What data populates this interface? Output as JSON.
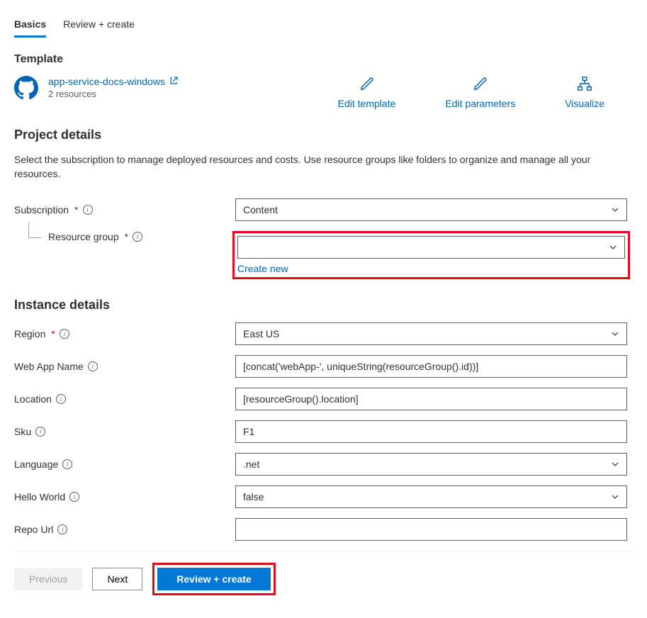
{
  "tabs": {
    "basics": "Basics",
    "review": "Review + create"
  },
  "template": {
    "heading": "Template",
    "link_text": "app-service-docs-windows",
    "sub_text": "2 resources",
    "actions": {
      "edit_template": "Edit template",
      "edit_parameters": "Edit parameters",
      "visualize": "Visualize"
    }
  },
  "project": {
    "heading": "Project details",
    "desc": "Select the subscription to manage deployed resources and costs. Use resource groups like folders to organize and manage all your resources.",
    "subscription_label": "Subscription",
    "subscription_value": "Content",
    "rg_label": "Resource group",
    "rg_value": "",
    "create_new": "Create new"
  },
  "instance": {
    "heading": "Instance details",
    "region_label": "Region",
    "region_value": "East US",
    "webapp_label": "Web App Name",
    "webapp_value": "[concat('webApp-', uniqueString(resourceGroup().id))]",
    "location_label": "Location",
    "location_value": "[resourceGroup().location]",
    "sku_label": "Sku",
    "sku_value": "F1",
    "language_label": "Language",
    "language_value": ".net",
    "hello_label": "Hello World",
    "hello_value": "false",
    "repo_label": "Repo Url",
    "repo_value": ""
  },
  "footer": {
    "previous": "Previous",
    "next": "Next",
    "review_create": "Review + create"
  }
}
